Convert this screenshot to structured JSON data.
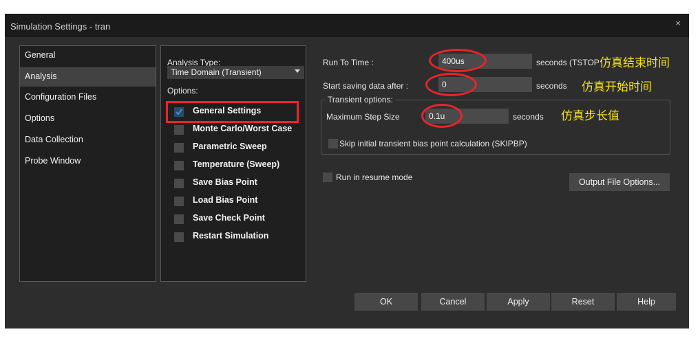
{
  "window": {
    "title": "Simulation Settings - tran",
    "close_glyph": "×"
  },
  "nav": {
    "items": [
      "General",
      "Analysis",
      "Configuration Files",
      "Options",
      "Data Collection",
      "Probe Window"
    ],
    "active": 1
  },
  "analysis": {
    "type_label": "Analysis Type:",
    "type_value": "Time Domain (Transient)",
    "options_label": "Options:",
    "options": [
      {
        "label": "General Settings",
        "checked": true
      },
      {
        "label": "Monte Carlo/Worst Case",
        "checked": false
      },
      {
        "label": "Parametric Sweep",
        "checked": false
      },
      {
        "label": "Temperature (Sweep)",
        "checked": false
      },
      {
        "label": "Save Bias Point",
        "checked": false
      },
      {
        "label": "Load Bias Point",
        "checked": false
      },
      {
        "label": "Save Check Point",
        "checked": false
      },
      {
        "label": "Restart Simulation",
        "checked": false
      }
    ]
  },
  "settings": {
    "run_to_time_label": "Run To Time :",
    "run_to_time_value": "400us",
    "run_to_time_unit": "seconds (TSTOP)",
    "start_saving_label": "Start saving data after :",
    "start_saving_value": "0",
    "start_saving_unit": "seconds",
    "transient_group_label": "Transient options:",
    "max_step_label": "Maximum Step Size",
    "max_step_value": "0.1u",
    "max_step_unit": "seconds",
    "skip_bias_label": "Skip initial transient bias point calculation (SKIPBP)",
    "resume_label": "Run in resume mode",
    "output_file_button": "Output File Options..."
  },
  "annotations": {
    "end_time": "仿真结束时间",
    "start_time": "仿真开始时间",
    "step_value": "仿真步长值"
  },
  "footer": {
    "ok": "OK",
    "cancel": "Cancel",
    "apply": "Apply",
    "reset": "Reset",
    "help": "Help"
  },
  "colors": {
    "background": "#2d2d2d",
    "titlebar": "#1b1b1b",
    "input": "#4a4a4a",
    "annotation": "#f5e118",
    "highlight": "#e8252b",
    "checkmark": "#3d8fd6"
  }
}
